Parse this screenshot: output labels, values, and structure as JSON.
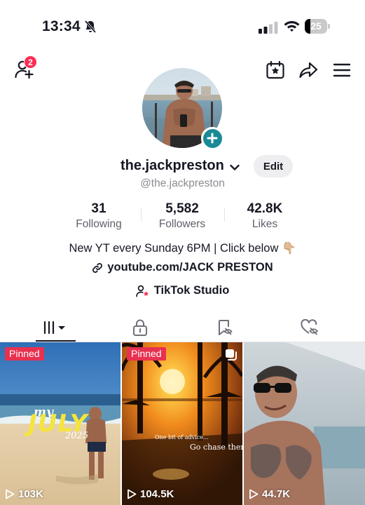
{
  "status_bar": {
    "time": "13:34",
    "battery": "25",
    "battery_level": 0.25
  },
  "header": {
    "friend_requests_badge": "2"
  },
  "profile": {
    "username": "the.jackpreston",
    "handle": "@the.jackpreston",
    "edit_label": "Edit",
    "stats": [
      {
        "value": "31",
        "label": "Following"
      },
      {
        "value": "5,582",
        "label": "Followers"
      },
      {
        "value": "42.8K",
        "label": "Likes"
      }
    ],
    "bio": "New YT every Sunday 6PM | Click below 👇🏼",
    "link": "youtube.com/JACK PRESTON",
    "studio_label": "TikTok Studio"
  },
  "tabs": [
    "videos-grid",
    "private",
    "reposts",
    "liked"
  ],
  "videos": [
    {
      "pinned_label": "Pinned",
      "views": "103K",
      "overlay_my": "my",
      "overlay_title": "JULY",
      "overlay_year": "2025"
    },
    {
      "pinned_label": "Pinned",
      "views": "104.5K",
      "caption_small": "One bit of advice...",
      "caption_main": "Go chase them sunsets"
    },
    {
      "views": "44.7K"
    }
  ],
  "colors": {
    "accent": "#fe2c55",
    "avatar_add": "#1a8a96",
    "text": "#161823",
    "muted": "#8a8b91"
  }
}
